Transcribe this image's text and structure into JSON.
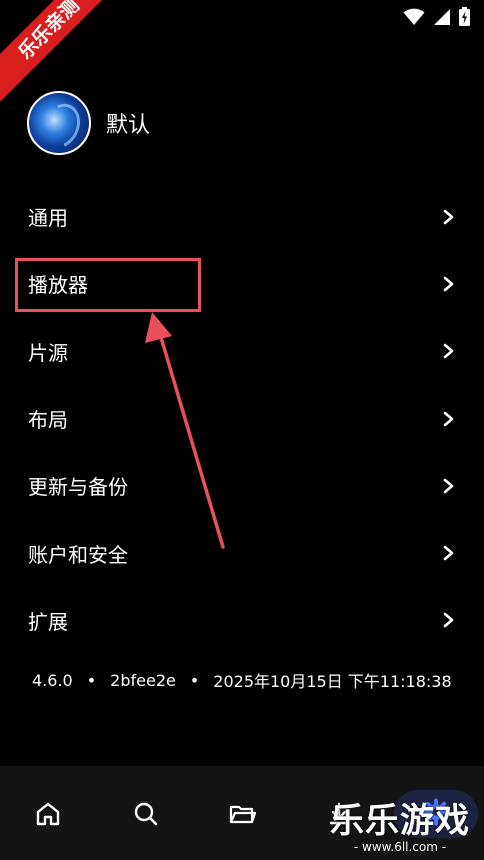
{
  "badge": "乐乐亲测",
  "profile": {
    "name": "默认"
  },
  "menu": [
    {
      "label": "通用"
    },
    {
      "label": "播放器"
    },
    {
      "label": "片源"
    },
    {
      "label": "布局"
    },
    {
      "label": "更新与备份"
    },
    {
      "label": "账户和安全"
    },
    {
      "label": "扩展"
    }
  ],
  "version": {
    "number": "4.6.0",
    "commit": "2bfee2e",
    "datetime": "2025年10月15日 下午11:18:38",
    "separator": "•"
  },
  "bottom_nav": [
    {
      "icon": "home-icon"
    },
    {
      "icon": "search-icon"
    },
    {
      "icon": "folder-icon"
    },
    {
      "icon": "download-icon"
    },
    {
      "icon": "settings-icon",
      "active": true
    }
  ],
  "watermark": {
    "title": "乐乐游戏",
    "url": "- www.6ll.com -"
  },
  "colors": {
    "highlight": "#e8505b",
    "accent": "#4a73ff",
    "nav_bg": "#141414"
  }
}
